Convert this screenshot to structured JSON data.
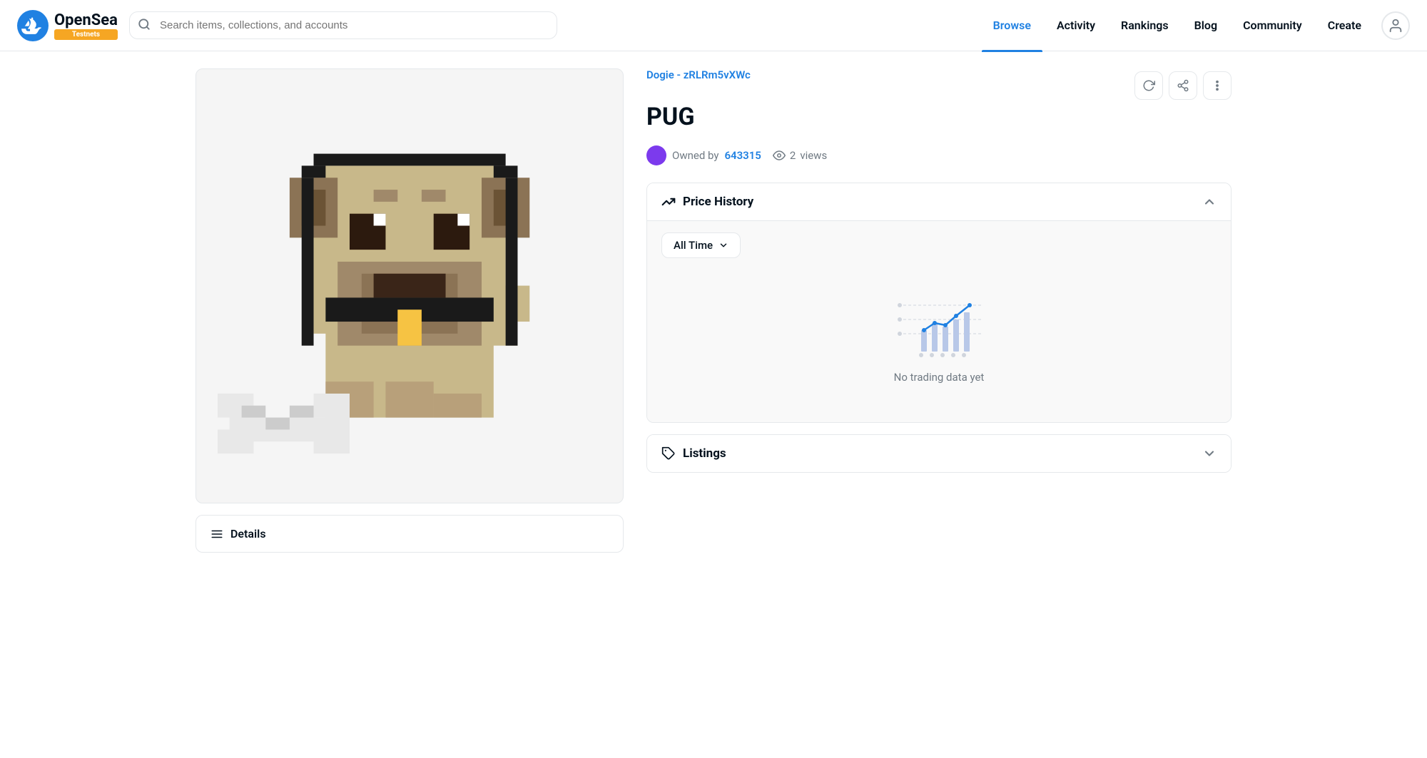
{
  "header": {
    "logo_text": "OpenSea",
    "badge": "Testnets",
    "search_placeholder": "Search items, collections, and accounts",
    "nav_items": [
      {
        "id": "browse",
        "label": "Browse",
        "active": true
      },
      {
        "id": "activity",
        "label": "Activity",
        "active": false
      },
      {
        "id": "rankings",
        "label": "Rankings",
        "active": false
      },
      {
        "id": "blog",
        "label": "Blog",
        "active": false
      },
      {
        "id": "community",
        "label": "Community",
        "active": false
      },
      {
        "id": "create",
        "label": "Create",
        "active": false
      }
    ]
  },
  "nft": {
    "collection": "Dogie - zRLRm5vXWc",
    "title": "PUG",
    "owner_label": "Owned by",
    "owner_id": "643315",
    "views_count": "2",
    "views_label": "views"
  },
  "price_history": {
    "title": "Price History",
    "time_filter": "All Time",
    "no_data_text": "No trading data yet"
  },
  "listings": {
    "title": "Listings"
  },
  "details": {
    "title": "Details"
  },
  "icons": {
    "search": "🔍",
    "refresh": "↻",
    "share": "↗",
    "more": "⋮",
    "trending": "〜",
    "tag": "🏷",
    "hamburger": "≡",
    "eye": "👁",
    "chevron_up": "∧",
    "chevron_down": "∨"
  }
}
